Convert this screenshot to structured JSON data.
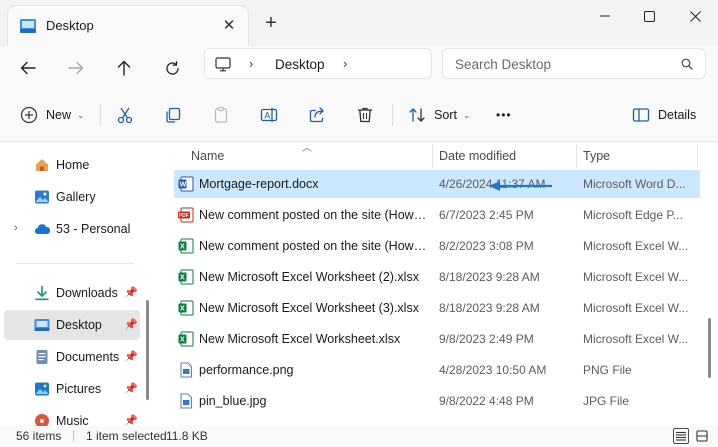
{
  "window": {
    "tab_title": "Desktop",
    "close_tab_glyph": "✕",
    "new_tab_glyph": "+"
  },
  "address": {
    "location": "Desktop"
  },
  "search": {
    "placeholder": "Search Desktop"
  },
  "toolbar": {
    "new_label": "New",
    "sort_label": "Sort",
    "details_label": "Details",
    "more_glyph": "•••"
  },
  "sidebar": {
    "items": [
      {
        "label": "Home",
        "icon": "home-icon"
      },
      {
        "label": "Gallery",
        "icon": "gallery-icon"
      },
      {
        "label": "53 - Personal",
        "icon": "onedrive-icon"
      },
      {
        "label": "Downloads",
        "icon": "download-icon"
      },
      {
        "label": "Desktop",
        "icon": "desktop-icon"
      },
      {
        "label": "Documents",
        "icon": "documents-icon"
      },
      {
        "label": "Pictures",
        "icon": "pictures-icon"
      },
      {
        "label": "Music",
        "icon": "music-icon"
      }
    ]
  },
  "columns": {
    "name": "Name",
    "date": "Date modified",
    "type": "Type"
  },
  "files": [
    {
      "name": "Mortgage-report.docx",
      "date": "4/26/2024 11:37 AM",
      "type": "Microsoft Word D...",
      "icon": "word-icon"
    },
    {
      "name": "New comment posted on the site (How t...",
      "date": "6/7/2023 2:45 PM",
      "type": "Microsoft Edge P...",
      "icon": "pdf-icon"
    },
    {
      "name": "New comment posted on the site (How t...",
      "date": "8/2/2023 3:08 PM",
      "type": "Microsoft Excel W...",
      "icon": "excel-icon"
    },
    {
      "name": "New Microsoft Excel Worksheet (2).xlsx",
      "date": "8/18/2023 9:28 AM",
      "type": "Microsoft Excel W...",
      "icon": "excel-icon"
    },
    {
      "name": "New Microsoft Excel Worksheet (3).xlsx",
      "date": "8/18/2023 9:28 AM",
      "type": "Microsoft Excel W...",
      "icon": "excel-icon"
    },
    {
      "name": "New Microsoft Excel Worksheet.xlsx",
      "date": "9/8/2023 2:49 PM",
      "type": "Microsoft Excel W...",
      "icon": "excel-icon"
    },
    {
      "name": "performance.png",
      "date": "4/28/2023 10:50 AM",
      "type": "PNG File",
      "icon": "image-file-icon"
    },
    {
      "name": "pin_blue.jpg",
      "date": "9/8/2022 4:48 PM",
      "type": "JPG File",
      "icon": "image-file-icon"
    }
  ],
  "status": {
    "item_count": "56 items",
    "selection": "1 item selected",
    "size": "11.8 KB"
  },
  "colors": {
    "accent": "#0067c0",
    "selected_row": "#cce8ff",
    "word": "#185abd",
    "excel": "#107c41",
    "pdf": "#c42b1c",
    "folder_blue": "#2d7ad6"
  }
}
